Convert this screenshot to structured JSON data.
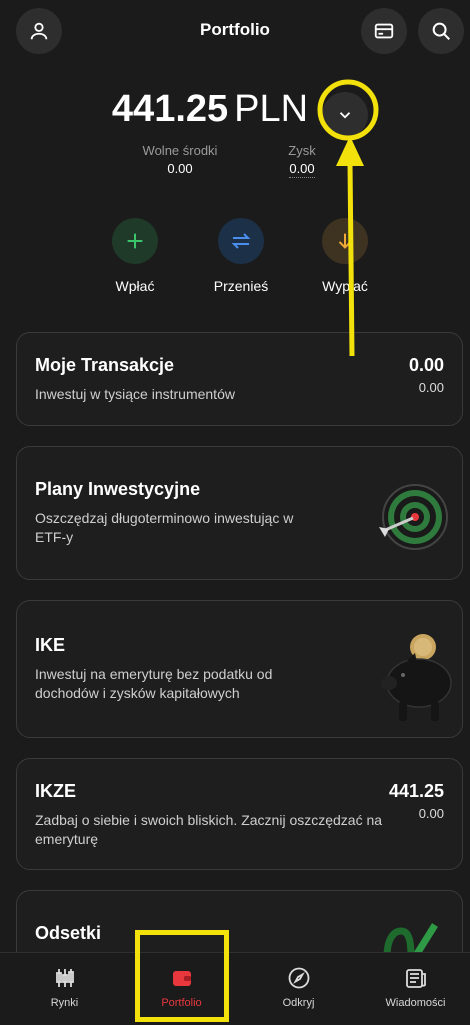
{
  "header": {
    "title": "Portfolio"
  },
  "balance": {
    "amount": "441.25",
    "currency": "PLN"
  },
  "stats": [
    {
      "label": "Wolne środki",
      "value": "0.00"
    },
    {
      "label": "Zysk",
      "value": "0.00"
    }
  ],
  "actions": [
    {
      "label": "Wpłać",
      "icon": "plus-icon",
      "color": "#3cc56a"
    },
    {
      "label": "Przenieś",
      "icon": "transfer-arrows-icon",
      "color": "#4a8ef0"
    },
    {
      "label": "Wypłać",
      "icon": "arrow-down-icon",
      "color": "#f0a838"
    }
  ],
  "cards": [
    {
      "title": "Moje Transakcje",
      "desc": "Inwestuj w tysiące instrumentów",
      "amount": "0.00",
      "sub": "0.00"
    },
    {
      "title": "Plany Inwestycyjne",
      "desc_line1": "Oszczędzaj długoterminowo inwestując w",
      "desc_line2": "ETF-y",
      "image": "target-dart-icon"
    },
    {
      "title": "IKE",
      "desc_line1": "Inwestuj na emeryturę bez podatku od",
      "desc_line2": "dochodów i zysków kapitałowych",
      "image": "piggy-bank-icon"
    },
    {
      "title": "IKZE",
      "desc_line1": "Zadbaj o siebie i swoich bliskich. Zacznij oszczędzać na",
      "desc_line2": "emeryturę",
      "amount": "441.25",
      "sub": "0.00"
    },
    {
      "title": "Odsetki",
      "image": "percent-icon"
    }
  ],
  "nav": [
    {
      "label": "Rynki",
      "icon": "candlestick-icon"
    },
    {
      "label": "Portfolio",
      "icon": "wallet-icon",
      "active": true
    },
    {
      "label": "Odkryj",
      "icon": "compass-icon"
    },
    {
      "label": "Wiadomości",
      "icon": "news-icon"
    }
  ],
  "colors": {
    "background": "#1b1b1b",
    "accent": "#e8373d",
    "annotation": "#f2e10a"
  }
}
